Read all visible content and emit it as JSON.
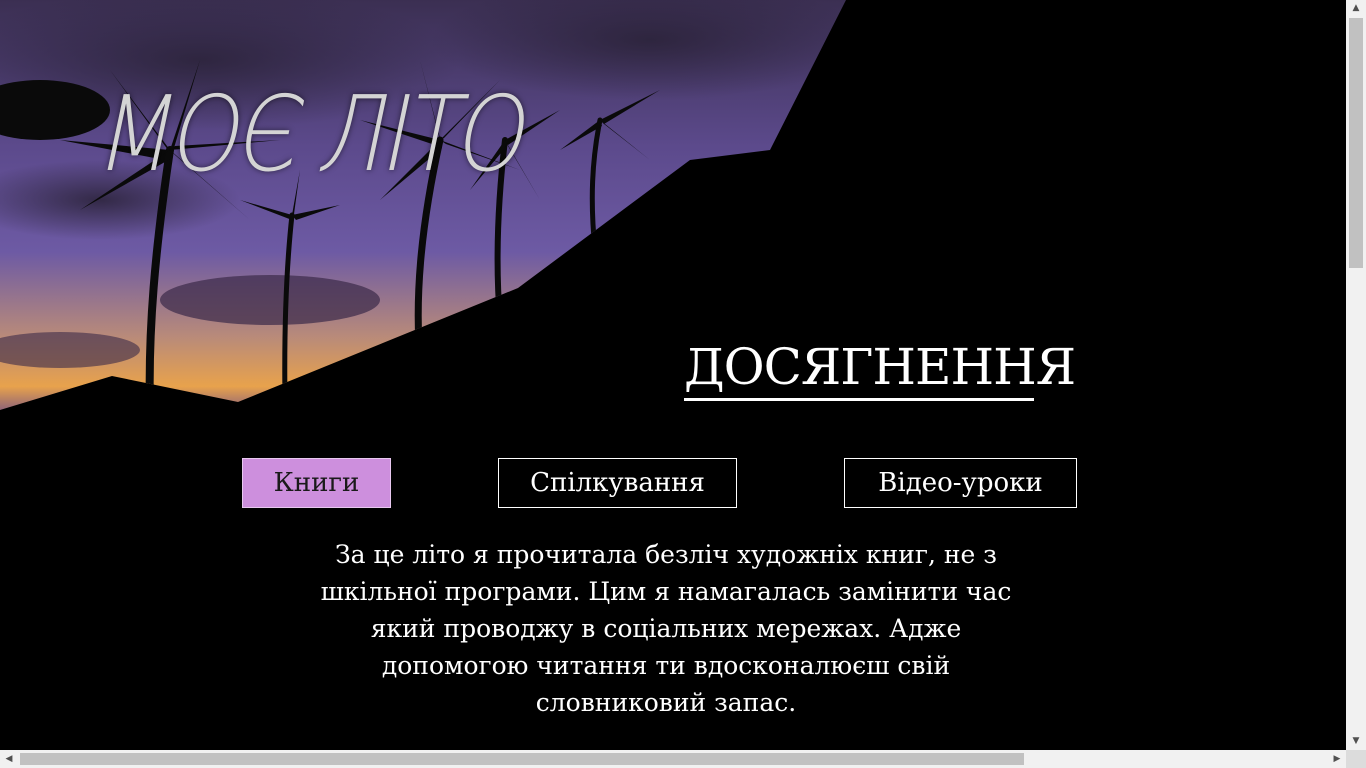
{
  "header": {
    "title": "МОЄ ЛІТО"
  },
  "achievements": {
    "title": "ДОСЯГНЕННЯ",
    "tabs": [
      {
        "label": "Книги",
        "active": true
      },
      {
        "label": "Спілкування",
        "active": false
      },
      {
        "label": "Відео-уроки",
        "active": false
      }
    ],
    "content": "За це літо я прочитала безліч художніх книг, не з шкільної програми. Цим я намагалась замінити час який проводжу в соціальних мережах. Адже допомогою читання ти вдосконалюєш свій словниковий запас."
  },
  "colors": {
    "background": "#000000",
    "active_tab": "#cd8fdd",
    "text": "#ffffff",
    "title": "#d4d4d4"
  },
  "icons": {
    "scroll_up": "triangle-up-icon",
    "scroll_down": "triangle-down-icon",
    "scroll_left": "triangle-left-icon",
    "scroll_right": "triangle-right-icon"
  }
}
